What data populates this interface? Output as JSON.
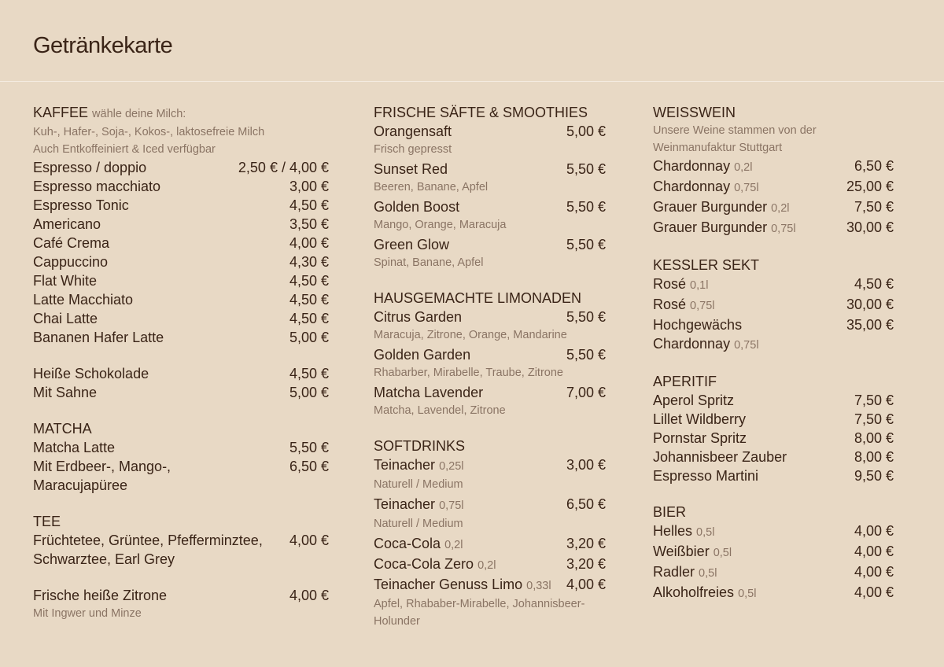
{
  "title": "Getränkekarte",
  "columns": [
    {
      "sections": [
        {
          "heading": "KAFFEE",
          "heading_note": "wähle deine Milch:",
          "notes": [
            "Kuh-, Hafer-, Soja-, Kokos-, laktosefreie Milch",
            "Auch Entkoffeiniert & Iced verfügbar"
          ],
          "items": [
            {
              "name": "Espresso / doppio",
              "price": "2,50 € / 4,00 €"
            },
            {
              "name": "Espresso macchiato",
              "price": "3,00 €"
            },
            {
              "name": "Espresso Tonic",
              "price": "4,50 €"
            },
            {
              "name": "Americano",
              "price": "3,50 €"
            },
            {
              "name": "Café Crema",
              "price": "4,00 €"
            },
            {
              "name": "Cappuccino",
              "price": "4,30 €"
            },
            {
              "name": "Flat White",
              "price": "4,50 €"
            },
            {
              "name": "Latte Macchiato",
              "price": "4,50 €"
            },
            {
              "name": "Chai Latte",
              "price": "4,50 €"
            },
            {
              "name": "Bananen Hafer Latte",
              "price": "5,00 €"
            }
          ]
        },
        {
          "heading": "",
          "items": [
            {
              "name": "Heiße Schokolade",
              "price": "4,50 €"
            },
            {
              "name": "Mit Sahne",
              "price": "5,00 €"
            }
          ]
        },
        {
          "heading": "MATCHA",
          "items": [
            {
              "name": "Matcha Latte",
              "price": "5,50 €"
            },
            {
              "name": "Mit Erdbeer-, Mango-, Maracujapüree",
              "price": "6,50 €"
            }
          ]
        },
        {
          "heading": "TEE",
          "items": [
            {
              "name": "Früchtetee, Grüntee, Pfefferminztee, Schwarztee, Earl Grey",
              "price": "4,00 €"
            }
          ]
        },
        {
          "heading": "",
          "items": [
            {
              "name": "Frische heiße Zitrone",
              "price": "4,00 €",
              "desc": "Mit Ingwer und Minze"
            }
          ]
        }
      ]
    },
    {
      "sections": [
        {
          "heading": "FRISCHE SÄFTE & SMOOTHIES",
          "items": [
            {
              "name": "Orangensaft",
              "price": "5,00 €",
              "desc": "Frisch gepresst"
            },
            {
              "name": "Sunset Red",
              "price": "5,50 €",
              "desc": "Beeren, Banane, Apfel"
            },
            {
              "name": "Golden Boost",
              "price": "5,50 €",
              "desc": "Mango, Orange, Maracuja"
            },
            {
              "name": "Green Glow",
              "price": "5,50 €",
              "desc": "Spinat, Banane, Apfel"
            }
          ]
        },
        {
          "heading": "HAUSGEMACHTE LIMONADEN",
          "items": [
            {
              "name": "Citrus Garden",
              "price": "5,50 €",
              "desc": "Maracuja, Zitrone, Orange, Mandarine"
            },
            {
              "name": "Golden Garden",
              "price": "5,50 €",
              "desc": "Rhabarber, Mirabelle, Traube, Zitrone"
            },
            {
              "name": "Matcha Lavender",
              "price": "7,00 €",
              "desc": "Matcha, Lavendel, Zitrone"
            }
          ]
        },
        {
          "heading": "SOFTDRINKS",
          "items": [
            {
              "name": "Teinacher",
              "size": "0,25l",
              "price": "3,00 €",
              "desc": "Naturell / Medium"
            },
            {
              "name": "Teinacher",
              "size": "0,75l",
              "price": "6,50 €",
              "desc": "Naturell / Medium"
            },
            {
              "name": "Coca-Cola",
              "size": "0,2l",
              "price": "3,20 €"
            },
            {
              "name": "Coca-Cola Zero",
              "size": "0,2l",
              "price": "3,20 €"
            },
            {
              "name": "Teinacher Genuss Limo",
              "size": "0,33l",
              "price": "4,00 €",
              "desc": "Apfel, Rhababer-Mirabelle, Johannisbeer-Holunder"
            }
          ]
        }
      ]
    },
    {
      "sections": [
        {
          "heading": "WEISSWEIN",
          "notes": [
            "Unsere Weine stammen von der Weinmanufaktur Stuttgart"
          ],
          "items": [
            {
              "name": "Chardonnay",
              "size": "0,2l",
              "price": "6,50 €"
            },
            {
              "name": "Chardonnay",
              "size": "0,75l",
              "price": "25,00 €"
            },
            {
              "name": "Grauer Burgunder",
              "size": "0,2l",
              "price": "7,50 €"
            },
            {
              "name": "Grauer Burgunder",
              "size": "0,75l",
              "price": "30,00 €"
            }
          ]
        },
        {
          "heading": "KESSLER SEKT",
          "items": [
            {
              "name": "Rosé",
              "size": "0,1l",
              "price": "4,50 €"
            },
            {
              "name": "Rosé",
              "size": "0,75l",
              "price": "30,00 €"
            },
            {
              "name": "Hochgewächs",
              "price": "35,00 €"
            },
            {
              "name": "Chardonnay",
              "size": "0,75l",
              "price": ""
            }
          ]
        },
        {
          "heading": "APERITIF",
          "items": [
            {
              "name": "Aperol Spritz",
              "price": "7,50 €"
            },
            {
              "name": "Lillet Wildberry",
              "price": "7,50 €"
            },
            {
              "name": "Pornstar Spritz",
              "price": "8,00 €"
            },
            {
              "name": "Johannisbeer Zauber",
              "price": "8,00 €"
            },
            {
              "name": "Espresso Martini",
              "price": "9,50 €"
            }
          ]
        },
        {
          "heading": "BIER",
          "items": [
            {
              "name": "Helles",
              "size": "0,5l",
              "price": "4,00 €"
            },
            {
              "name": "Weißbier",
              "size": "0,5l",
              "price": "4,00 €"
            },
            {
              "name": "Radler",
              "size": "0,5l",
              "price": "4,00 €"
            },
            {
              "name": "Alkoholfreies",
              "size": "0,5l",
              "price": "4,00 €"
            }
          ]
        }
      ]
    }
  ]
}
